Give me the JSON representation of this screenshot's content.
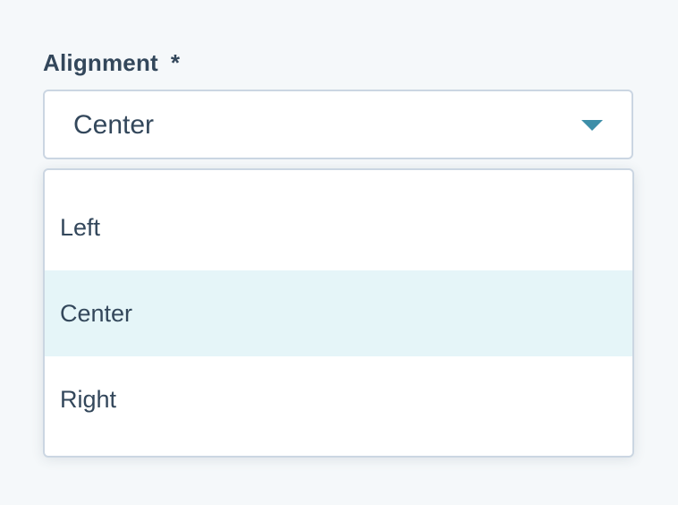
{
  "field": {
    "label": "Alignment",
    "required_mark": "*"
  },
  "select": {
    "value": "Center",
    "icon": "caret-down-icon"
  },
  "menu": {
    "options": [
      {
        "label": "Left",
        "selected": false
      },
      {
        "label": "Center",
        "selected": true
      },
      {
        "label": "Right",
        "selected": false
      }
    ]
  },
  "colors": {
    "text": "#33475b",
    "border": "#cbd6e2",
    "accent": "#3d8ea8",
    "selected_bg": "#e5f5f8",
    "page_bg": "#f5f8fa"
  }
}
